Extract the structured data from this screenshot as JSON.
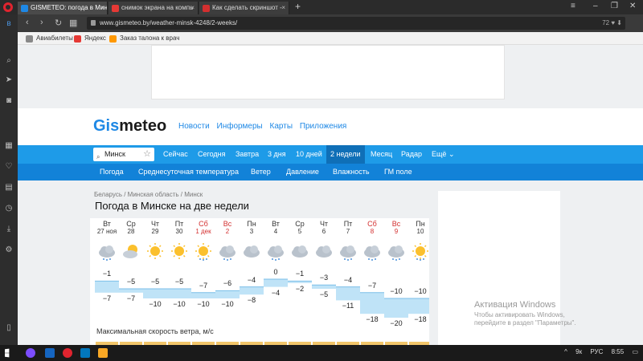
{
  "browser": {
    "tabs": [
      {
        "label": "GISMETEO: погода в Мин",
        "icon_color": "#1e88e5",
        "active": true
      },
      {
        "label": "снимок экрана на компь",
        "icon_color": "#e53935",
        "active": false
      },
      {
        "label": "Как сделать скриншот - ",
        "icon_color": "#d32f2f",
        "active": false
      }
    ],
    "new_tab": "+",
    "url": "www.gismeteo.by/weather-minsk-4248/2-weeks/",
    "addr_right": "72",
    "bookmarks": [
      {
        "label": "Авиабилеты",
        "icon_color": "#888888"
      },
      {
        "label": "Яндекс",
        "icon_color": "#e53935"
      },
      {
        "label": "Заказ талона к врач",
        "icon_color": "#ff9800"
      }
    ]
  },
  "site": {
    "logo_blue": "Gis",
    "logo_dark": "meteo",
    "nav": [
      "Новости",
      "Информеры",
      "Карты",
      "Приложения"
    ],
    "search_value": "Минск",
    "main_tabs": [
      "Сейчас",
      "Сегодня",
      "Завтра",
      "3 дня",
      "10 дней",
      "2 недели",
      "Месяц",
      "Радар",
      "Ещё"
    ],
    "active_tab": "2 недели",
    "sub_tabs": [
      "Погода",
      "Среднесуточная температура",
      "Ветер",
      "Давление",
      "Влажность",
      "ГМ поле"
    ],
    "breadcrumb": [
      "Беларусь",
      "Минская область",
      "Минск"
    ],
    "title": "Погода в Минске на две недели",
    "wind_title": "Максимальная скорость ветра, м/с"
  },
  "forecast": {
    "days": [
      {
        "name": "Вт",
        "date": "27 ноя",
        "weekend": false,
        "icon": "cloud-snow",
        "max": "−1",
        "min": "−7"
      },
      {
        "name": "Ср",
        "date": "28",
        "weekend": false,
        "icon": "sun-cloud",
        "max": "−5",
        "min": "−7"
      },
      {
        "name": "Чт",
        "date": "29",
        "weekend": false,
        "icon": "sun",
        "max": "−5",
        "min": "−10"
      },
      {
        "name": "Пт",
        "date": "30",
        "weekend": false,
        "icon": "sun",
        "max": "−5",
        "min": "−10"
      },
      {
        "name": "Сб",
        "date": "1 дек",
        "weekend": true,
        "icon": "sun-snow",
        "max": "−7",
        "min": "−10"
      },
      {
        "name": "Вс",
        "date": "2",
        "weekend": true,
        "icon": "cloud-snow",
        "max": "−6",
        "min": "−10"
      },
      {
        "name": "Пн",
        "date": "3",
        "weekend": false,
        "icon": "cloud",
        "max": "−4",
        "min": "−8"
      },
      {
        "name": "Вт",
        "date": "4",
        "weekend": false,
        "icon": "cloud-snow",
        "max": "0",
        "min": "−4"
      },
      {
        "name": "Ср",
        "date": "5",
        "weekend": false,
        "icon": "cloud",
        "max": "−1",
        "min": "−2"
      },
      {
        "name": "Чт",
        "date": "6",
        "weekend": false,
        "icon": "cloud",
        "max": "−3",
        "min": "−5"
      },
      {
        "name": "Пт",
        "date": "7",
        "weekend": false,
        "icon": "cloud-snow",
        "max": "−4",
        "min": "−11"
      },
      {
        "name": "Сб",
        "date": "8",
        "weekend": true,
        "icon": "cloud-snow",
        "max": "−7",
        "min": "−18"
      },
      {
        "name": "Вс",
        "date": "9",
        "weekend": true,
        "icon": "cloud-snow",
        "max": "−10",
        "min": "−20"
      },
      {
        "name": "Пн",
        "date": "10",
        "weekend": false,
        "icon": "sun-snow",
        "max": "−10",
        "min": "−18"
      }
    ]
  },
  "activation": {
    "title": "Активация Windows",
    "text": "Чтобы активировать Windows, перейдите в раздел \"Параметры\"."
  },
  "taskbar": {
    "tray": [
      "9к",
      "РУС",
      "8:55"
    ]
  },
  "colors": {
    "accent": "#1e9be8",
    "accent_dark": "#1282d8",
    "active_tab": "#0f6fb7",
    "weekend": "#d32f2f",
    "chart_fill": "#bfe3f7"
  }
}
